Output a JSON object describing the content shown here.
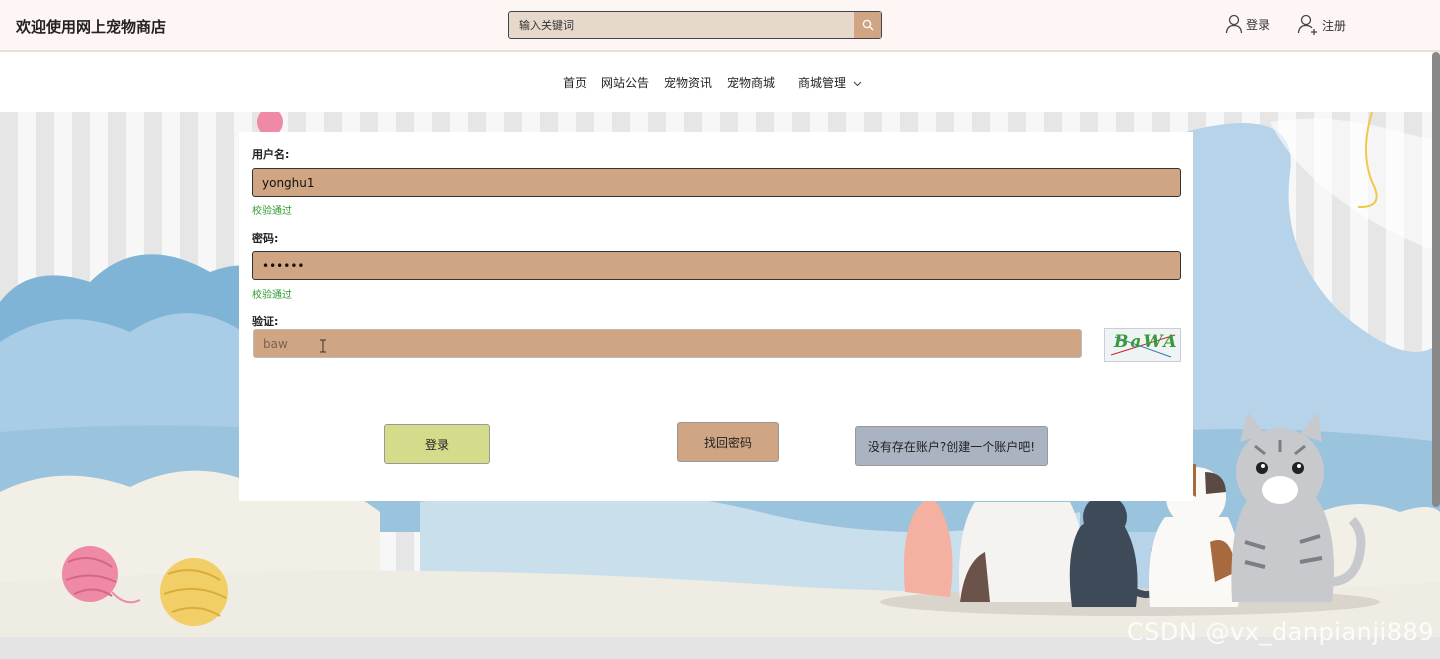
{
  "header": {
    "brand": "欢迎使用网上宠物商店",
    "search_placeholder": "输入关键词",
    "login_label": "登录",
    "register_label": "注册"
  },
  "nav": {
    "items": [
      "首页",
      "网站公告",
      "宠物资讯",
      "宠物商城"
    ],
    "manage_label": "商城管理"
  },
  "form": {
    "username_label": "用户名:",
    "username_value": "yonghu1",
    "username_hint": "校验通过",
    "password_label": "密码:",
    "password_value": "••••••",
    "password_hint": "校验通过",
    "captcha_label": "验证:",
    "captcha_placeholder": "baw",
    "captcha_text": "BaWA"
  },
  "buttons": {
    "login": "登录",
    "recover": "找回密码",
    "register": "没有存在账户?创建一个账户吧!"
  },
  "watermark": "CSDN @vx_danpianji889",
  "colors": {
    "input_bg": "#cfa584",
    "login_btn": "#d4dc8c",
    "recover_btn": "#cfa584",
    "register_btn": "#a9b3c2",
    "hint_green": "#2f9a2f"
  }
}
